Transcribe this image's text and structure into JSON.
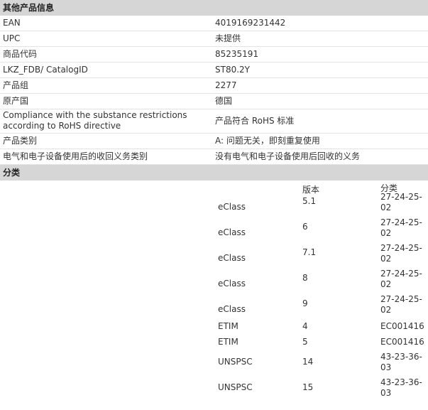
{
  "info": {
    "header": "其他产品信息",
    "rows": [
      {
        "label": "EAN",
        "value": "4019169231442"
      },
      {
        "label": "UPC",
        "value": "未提供"
      },
      {
        "label": "商品代码",
        "value": "85235191"
      },
      {
        "label": "LKZ_FDB/ CatalogID",
        "value": "ST80.2Y"
      },
      {
        "label": "产品组",
        "value": "2277"
      },
      {
        "label": "原产国",
        "value": "德国"
      },
      {
        "label": "Compliance with the substance restrictions according to RoHS directive",
        "value": "产品符合 RoHS 标准"
      },
      {
        "label": "产品类别",
        "value": "A: 问题无关，即刻重复使用"
      },
      {
        "label": "电气和电子设备使用后的收回义务类别",
        "value": "没有电气和电子设备使用后回收的义务"
      }
    ]
  },
  "classification": {
    "header": "分类",
    "col_version": "版本",
    "col_category": "分类",
    "rows": [
      {
        "system": "eClass",
        "version": "5.1",
        "category": "27-24-25-02"
      },
      {
        "system": "eClass",
        "version": "6",
        "category": "27-24-25-02"
      },
      {
        "system": "eClass",
        "version": "7.1",
        "category": "27-24-25-02"
      },
      {
        "system": "eClass",
        "version": "8",
        "category": "27-24-25-02"
      },
      {
        "system": "eClass",
        "version": "9",
        "category": "27-24-25-02"
      },
      {
        "system": "ETIM",
        "version": "4",
        "category": "EC001416"
      },
      {
        "system": "ETIM",
        "version": "5",
        "category": "EC001416"
      },
      {
        "system": "UNSPSC",
        "version": "14",
        "category": "43-23-36-03"
      },
      {
        "system": "UNSPSC",
        "version": "15",
        "category": "43-23-36-03"
      }
    ]
  }
}
